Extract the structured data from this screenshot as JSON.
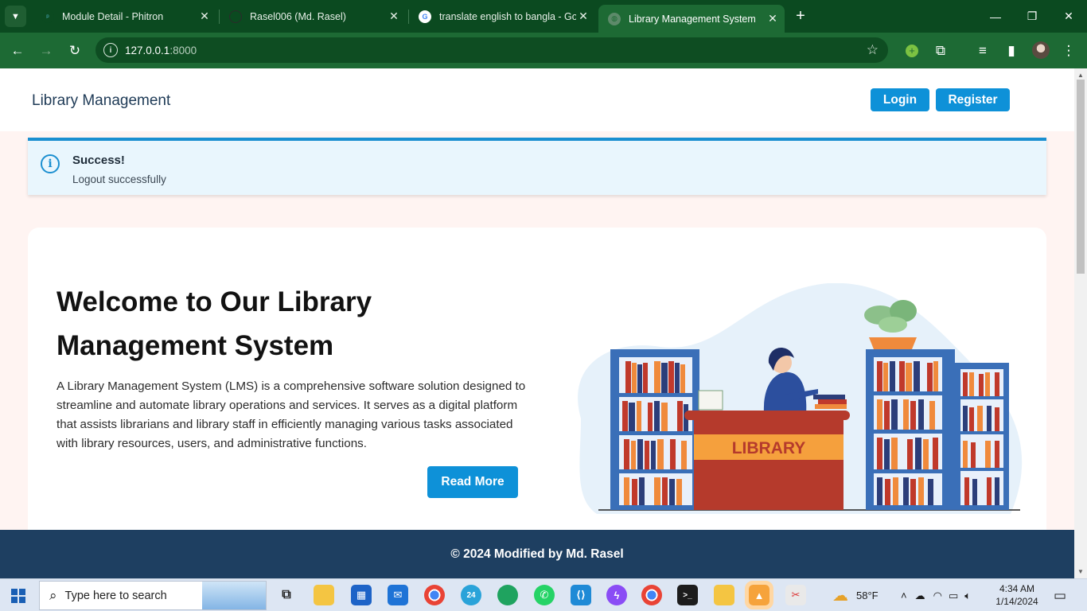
{
  "browser": {
    "tabs": [
      {
        "title": "Module Detail - Phitron",
        "active": false
      },
      {
        "title": "Rasel006 (Md. Rasel)",
        "active": false
      },
      {
        "title": "translate english to bangla - Go",
        "active": false
      },
      {
        "title": "Library Management System",
        "active": true
      }
    ],
    "url_host": "127.0.0.1",
    "url_port": ":8000"
  },
  "navbar": {
    "brand": "Library Management",
    "login_label": "Login",
    "register_label": "Register"
  },
  "alert": {
    "title": "Success!",
    "message": "Logout successfully"
  },
  "hero": {
    "heading": "Welcome to Our Library Management System",
    "description": "A Library Management System (LMS) is a comprehensive software solution designed to streamline and automate library operations and services. It serves as a digital platform that assists librarians and library staff in efficiently managing various tasks associated with library resources, users, and administrative functions.",
    "read_more_label": "Read More",
    "illustration_sign": "LIBRARY"
  },
  "footer": {
    "text": "© 2024 Modified by Md. Rasel"
  },
  "taskbar": {
    "search_placeholder": "Type here to search",
    "telegram_badge": "24",
    "weather": "58°F",
    "time": "4:34 AM",
    "date": "1/14/2024"
  },
  "colors": {
    "accent": "#0e91d8",
    "browser_frame": "#1d6a34",
    "footer_bg": "#1e3f61",
    "page_bg": "#fff4f2"
  }
}
